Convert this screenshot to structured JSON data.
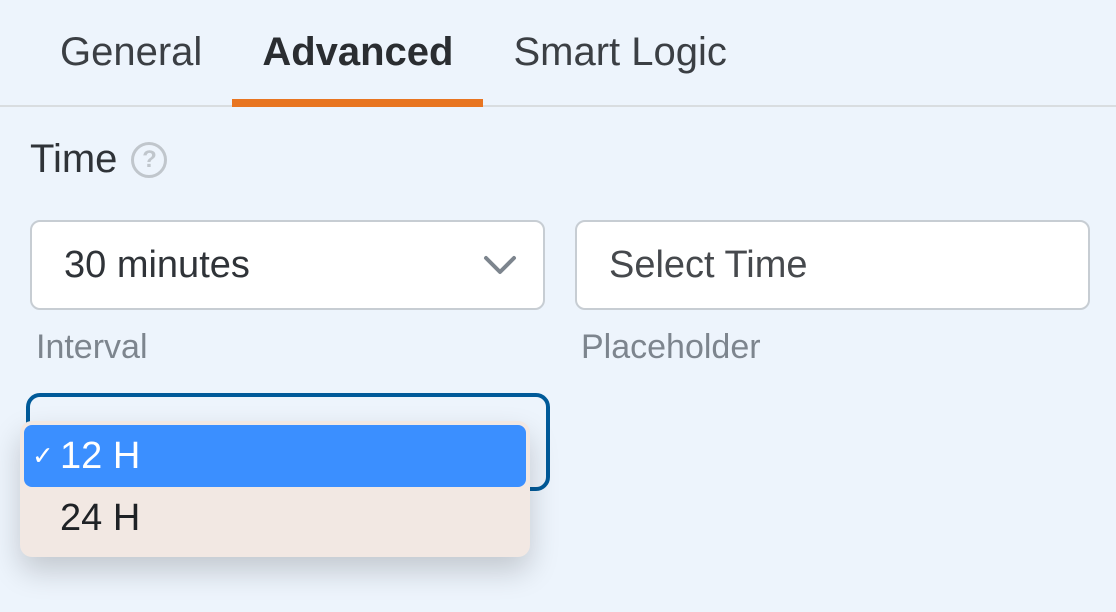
{
  "tabs": {
    "general": "General",
    "advanced": "Advanced",
    "smart_logic": "Smart Logic",
    "active": "advanced"
  },
  "section": {
    "title": "Time"
  },
  "interval": {
    "value": "30 minutes",
    "label": "Interval"
  },
  "placeholder": {
    "value": "Select Time",
    "label": "Placeholder"
  },
  "format_dropdown": {
    "options": [
      "12 H",
      "24 H"
    ],
    "selected": "12 H"
  }
}
